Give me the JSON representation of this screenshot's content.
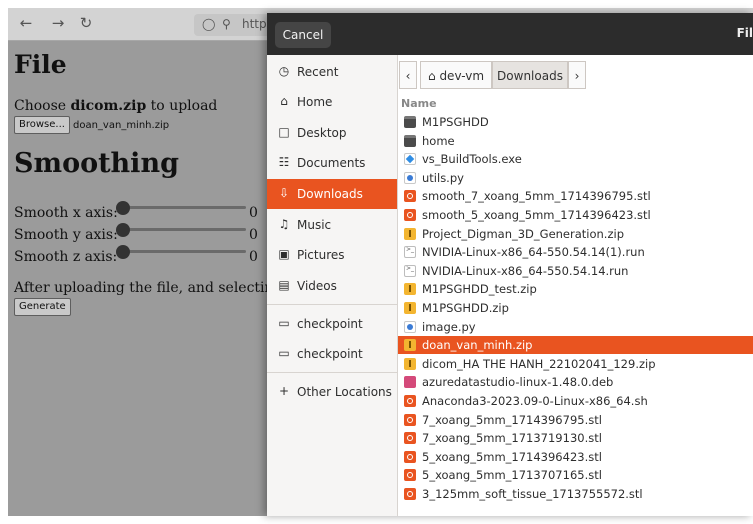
{
  "browser": {
    "back_icon": "arrow-left-icon",
    "forward_icon": "arrow-right-icon",
    "reload_icon": "reload-icon",
    "url_partial": "http"
  },
  "page": {
    "file_heading": "File",
    "choose_prefix": "Choose ",
    "choose_bold": "dicom.zip",
    "choose_suffix": " to upload",
    "browse_label": "Browse...",
    "selected_file": "doan_van_minh.zip",
    "smoothing_heading": "Smoothing",
    "sliders": [
      {
        "label": "Smooth x axis:",
        "value": "0"
      },
      {
        "label": "Smooth y axis:",
        "value": "0"
      },
      {
        "label": "Smooth z axis:",
        "value": "0"
      }
    ],
    "after_text": "After uploading the file, and selecting t",
    "generate_label": "Generate"
  },
  "dialog": {
    "cancel_label": "Cancel",
    "title_partial": "Fil",
    "sidebar": [
      {
        "label": "Recent",
        "icon": "clock-icon",
        "glyph": "◷"
      },
      {
        "label": "Home",
        "icon": "home-icon",
        "glyph": "⌂"
      },
      {
        "label": "Desktop",
        "icon": "desktop-icon",
        "glyph": "□"
      },
      {
        "label": "Documents",
        "icon": "document-icon",
        "glyph": "☷"
      },
      {
        "label": "Downloads",
        "icon": "download-icon",
        "glyph": "⇩"
      },
      {
        "label": "Music",
        "icon": "music-icon",
        "glyph": "♫"
      },
      {
        "label": "Pictures",
        "icon": "picture-icon",
        "glyph": "▣"
      },
      {
        "label": "Videos",
        "icon": "video-icon",
        "glyph": "▤"
      },
      {
        "label": "checkpoint",
        "icon": "folder-icon",
        "glyph": "▭"
      },
      {
        "label": "checkpoint",
        "icon": "folder-icon",
        "glyph": "▭"
      },
      {
        "label": "Other Locations",
        "icon": "plus-icon",
        "glyph": "+"
      }
    ],
    "path": {
      "left_arrow": "‹",
      "home_segment": "dev-vm",
      "current_segment": "Downloads",
      "right_arrow": "›"
    },
    "column_header": "Name",
    "files": [
      {
        "name": "M1PSGHDD",
        "type": "folder"
      },
      {
        "name": "home",
        "type": "folder"
      },
      {
        "name": "vs_BuildTools.exe",
        "type": "exe"
      },
      {
        "name": "utils.py",
        "type": "py"
      },
      {
        "name": "smooth_7_xoang_5mm_1714396795.stl",
        "type": "stl"
      },
      {
        "name": "smooth_5_xoang_5mm_1714396423.stl",
        "type": "stl"
      },
      {
        "name": "Project_Digman_3D_Generation.zip",
        "type": "zip"
      },
      {
        "name": "NVIDIA-Linux-x86_64-550.54.14(1).run",
        "type": "run"
      },
      {
        "name": "NVIDIA-Linux-x86_64-550.54.14.run",
        "type": "run"
      },
      {
        "name": "M1PSGHDD_test.zip",
        "type": "zip"
      },
      {
        "name": "M1PSGHDD.zip",
        "type": "zip"
      },
      {
        "name": "image.py",
        "type": "py"
      },
      {
        "name": "doan_van_minh.zip",
        "type": "zip",
        "selected": true
      },
      {
        "name": "dicom_HA THE HANH_22102041_129.zip",
        "type": "zip"
      },
      {
        "name": "azuredatastudio-linux-1.48.0.deb",
        "type": "deb"
      },
      {
        "name": "Anaconda3-2023.09-0-Linux-x86_64.sh",
        "type": "sh"
      },
      {
        "name": "7_xoang_5mm_1714396795.stl",
        "type": "stl"
      },
      {
        "name": "7_xoang_5mm_1713719130.stl",
        "type": "stl"
      },
      {
        "name": "5_xoang_5mm_1714396423.stl",
        "type": "stl"
      },
      {
        "name": "5_xoang_5mm_1713707165.stl",
        "type": "stl"
      },
      {
        "name": "3_125mm_soft_tissue_1713755572.stl",
        "type": "stl"
      }
    ]
  },
  "colors": {
    "accent": "#e95420",
    "header_bg": "#2c2c2c",
    "page_overlay": "#9b9b9b"
  }
}
